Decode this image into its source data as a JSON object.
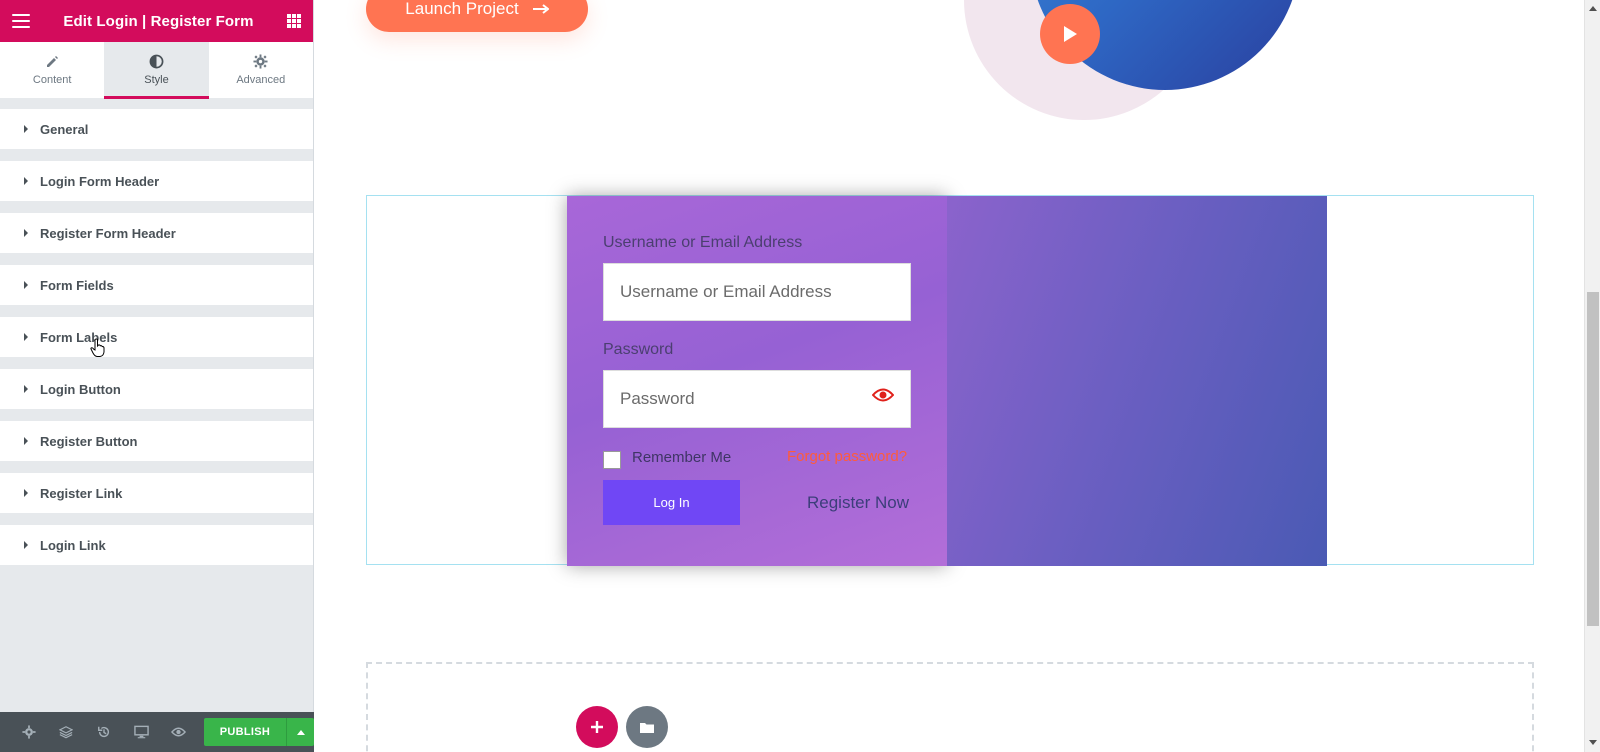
{
  "panel": {
    "title": "Edit Login | Register Form",
    "tabs": [
      {
        "label": "Content",
        "icon": "pencil-icon"
      },
      {
        "label": "Style",
        "icon": "contrast-icon"
      },
      {
        "label": "Advanced",
        "icon": "gear-icon"
      }
    ],
    "active_tab": "Style",
    "sections": [
      {
        "label": "General"
      },
      {
        "label": "Login Form Header"
      },
      {
        "label": "Register Form Header"
      },
      {
        "label": "Form Fields"
      },
      {
        "label": "Form Labels"
      },
      {
        "label": "Login Button"
      },
      {
        "label": "Register Button"
      },
      {
        "label": "Register Link"
      },
      {
        "label": "Login Link"
      }
    ],
    "footer": {
      "icons": [
        "settings-icon",
        "layers-icon",
        "history-icon",
        "responsive-icon",
        "preview-eye-icon"
      ],
      "publish_label": "PUBLISH"
    }
  },
  "canvas": {
    "launch_button_label": "Launch Project",
    "login_form": {
      "username_label": "Username or Email Address",
      "username_placeholder": "Username or Email Address",
      "password_label": "Password",
      "password_placeholder": "Password",
      "remember_label": "Remember Me",
      "forgot_label": "Forgot password?",
      "login_button_label": "Log In",
      "register_link_label": "Register Now"
    }
  },
  "colors": {
    "brand": "#d30c5c",
    "publish": "#39b54a",
    "accent_orange": "#ff7452",
    "login_button": "#7047f5"
  }
}
